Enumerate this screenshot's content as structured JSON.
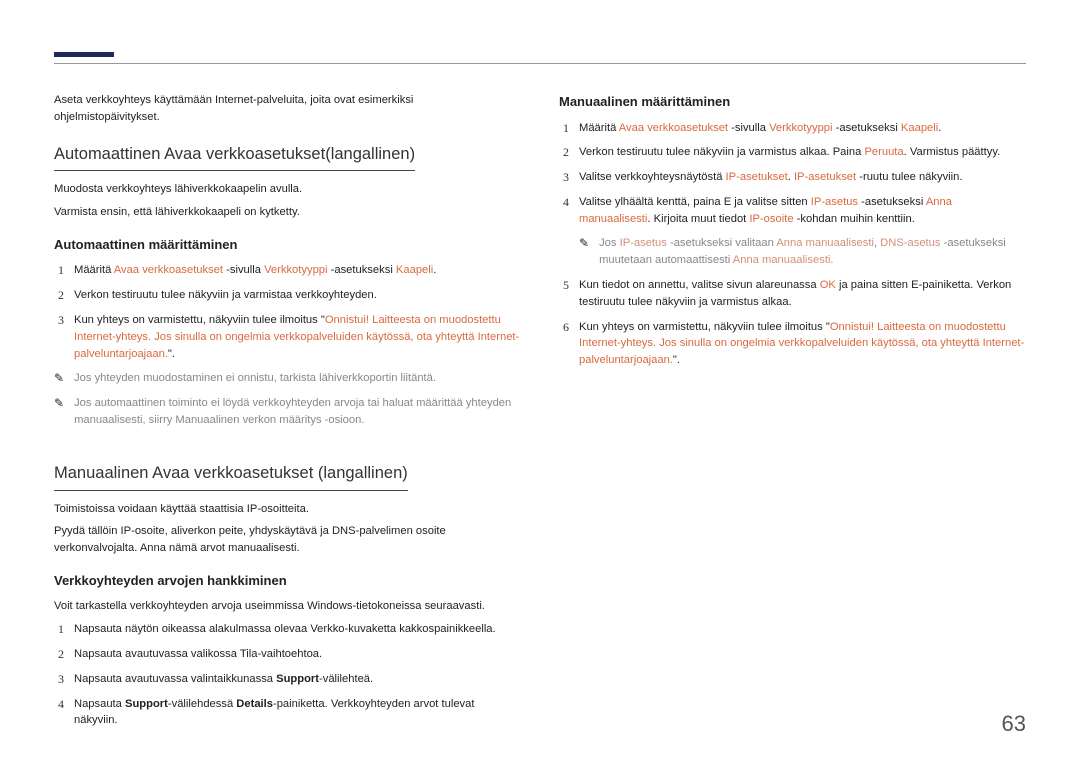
{
  "pageNumber": "63",
  "colLeft": {
    "intro": "Aseta verkkoyhteys käyttämään Internet-palveluita, joita ovat esimerkiksi ohjelmistopäivitykset.",
    "section1": {
      "title": "Automaattinen  Avaa verkkoasetukset(langallinen)",
      "p1": "Muodosta verkkoyhteys lähiverkkokaapelin avulla.",
      "p2": "Varmista ensin, että lähiverkkokaapeli on kytketty.",
      "sub1": {
        "title": "Automaattinen määrittäminen",
        "step1": {
          "pre": "Määritä ",
          "a1": "Avaa verkkoasetukset",
          "mid1": " -sivulla ",
          "a2": "Verkkotyyppi",
          "mid2": " -asetukseksi ",
          "a3": "Kaapeli",
          "post": "."
        },
        "step2": "Verkon testiruutu tulee näkyviin ja varmistaa verkkoyhteyden.",
        "step3": {
          "pre": "Kun yhteys on varmistettu, näkyviin tulee ilmoitus \"",
          "accent": "Onnistui! Laitteesta on muodostettu Internet-yhteys. Jos sinulla on ongelmia verkkopalveluiden käytössä, ota yhteyttä Internet-palveluntarjoajaan.",
          "post": "\"."
        },
        "note1": "Jos yhteyden muodostaminen ei onnistu, tarkista lähiverkkoportin liitäntä.",
        "note2": "Jos automaattinen toiminto ei löydä verkkoyhteyden arvoja tai haluat määrittää yhteyden manuaalisesti, siirry Manuaalinen verkon määritys -osioon."
      }
    },
    "section2": {
      "title": "Manuaalinen Avaa verkkoasetukset (langallinen)",
      "p1": "Toimistoissa voidaan käyttää staattisia IP-osoitteita.",
      "p2": "Pyydä tällöin IP-osoite, aliverkon peite, yhdyskäytävä ja DNS-palvelimen osoite verkonvalvojalta. Anna nämä arvot manuaalisesti.",
      "sub1": {
        "title": "Verkkoyhteyden arvojen hankkiminen",
        "intro": "Voit tarkastella verkkoyhteyden arvoja useimmissa Windows-tietokoneissa seuraavasti.",
        "step1": "Napsauta näytön oikeassa alakulmassa olevaa Verkko-kuvaketta kakkospainikkeella.",
        "step2": "Napsauta avautuvassa valikossa Tila-vaihtoehtoa.",
        "step3": {
          "pre": "Napsauta avautuvassa valintaikkunassa ",
          "b1": "Support",
          "post": "-välilehteä."
        },
        "step4": {
          "pre": "Napsauta ",
          "b1": "Support",
          "mid1": "-välilehdessä ",
          "b2": "Details",
          "post": "-painiketta. Verkkoyhteyden arvot tulevat näkyviin."
        }
      }
    }
  },
  "colRight": {
    "sub1": {
      "title": "Manuaalinen määrittäminen",
      "step1": {
        "pre": "Määritä ",
        "a1": "Avaa verkkoasetukset",
        "mid1": " -sivulla ",
        "a2": "Verkkotyyppi",
        "mid2": " -asetukseksi ",
        "a3": "Kaapeli",
        "post": "."
      },
      "step2": {
        "pre": "Verkon testiruutu tulee näkyviin ja varmistus alkaa. Paina ",
        "a1": "Peruuta",
        "post": ". Varmistus päättyy."
      },
      "step3": {
        "pre": "Valitse verkkoyhteysnäytöstä ",
        "a1": "IP-asetukset",
        "mid1": ". ",
        "a2": "IP-asetukset",
        "post": " -ruutu tulee näkyviin."
      },
      "step4": {
        "pre": "Valitse ylhäältä kenttä, paina ",
        "k1": "E",
        "mid1": " ja valitse sitten ",
        "a1": "IP-asetus",
        "mid2": " -asetukseksi ",
        "a2": "Anna manuaalisesti",
        "mid3": ". Kirjoita muut tiedot ",
        "a3": "IP-osoite",
        "post": " -kohdan muihin kenttiin."
      },
      "note1": {
        "pre": "Jos ",
        "a1": "IP-asetus",
        "mid1": " -asetukseksi valitaan ",
        "a2": "Anna manuaalisesti",
        "mid2": ", ",
        "a3": "DNS-asetus",
        "mid3": " -asetukseksi muutetaan automaattisesti ",
        "a4": "Anna manuaalisesti",
        "post": "."
      },
      "step5": {
        "pre": "Kun tiedot on annettu, valitse sivun alareunassa ",
        "a1": "OK",
        "mid1": " ja paina sitten ",
        "k1": "E",
        "post": "-painiketta. Verkon testiruutu tulee näkyviin ja varmistus alkaa."
      },
      "step6": {
        "pre": "Kun yhteys on varmistettu, näkyviin tulee ilmoitus \"",
        "accent": "Onnistui! Laitteesta on muodostettu Internet-yhteys. Jos sinulla on ongelmia verkkopalveluiden käytössä, ota yhteyttä Internet-palveluntarjoajaan.",
        "post": "\"."
      }
    }
  }
}
